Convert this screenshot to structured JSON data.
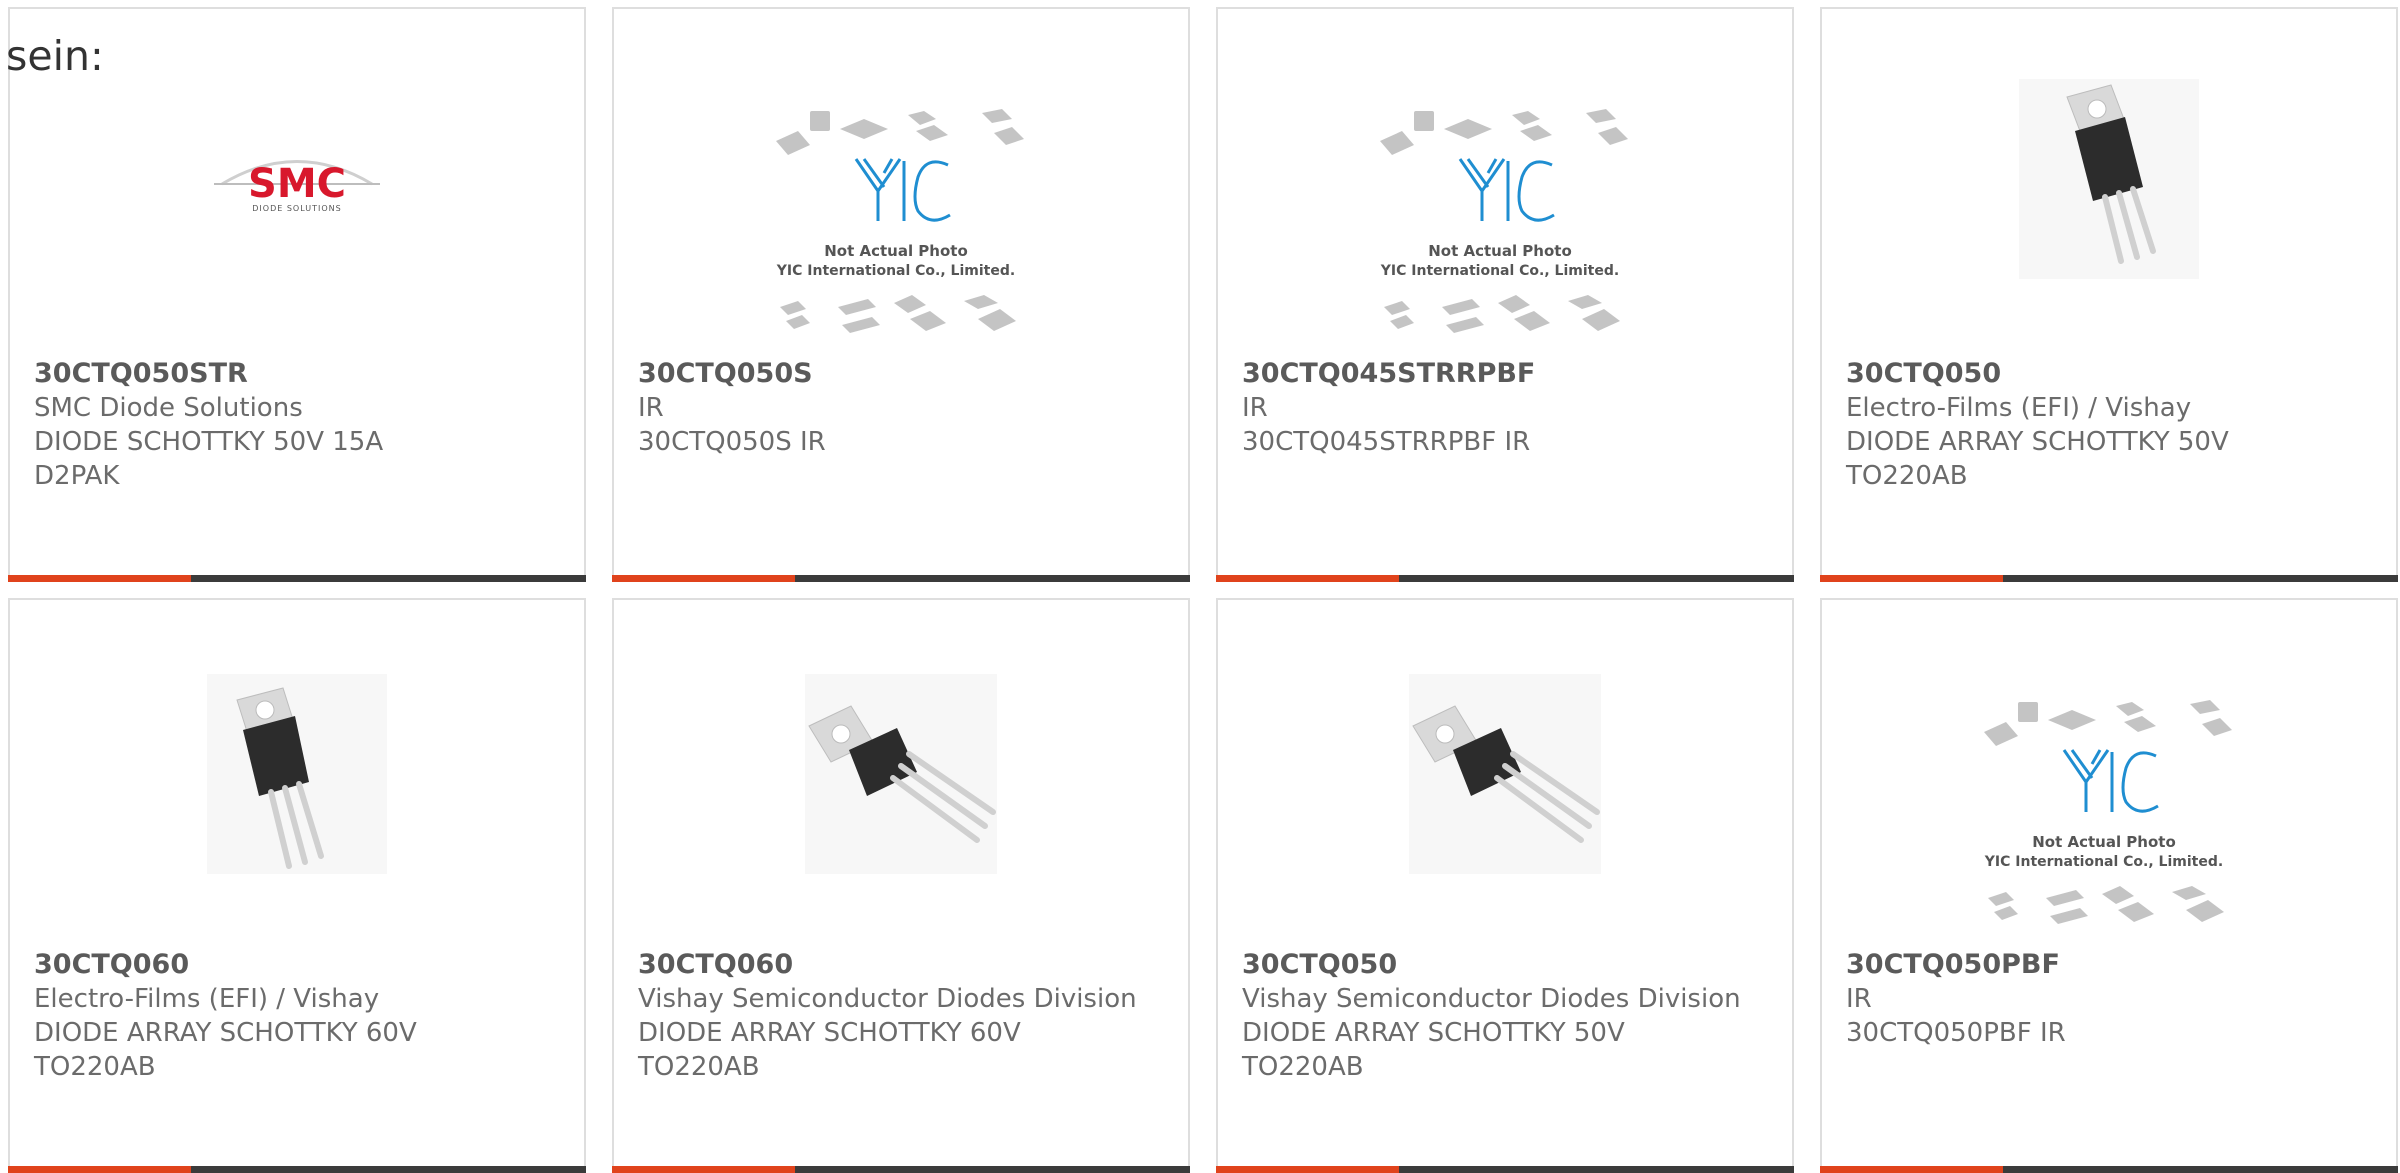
{
  "heading": "sein:",
  "products": [
    {
      "part": "30CTQ050STR",
      "maker": "SMC Diode Solutions",
      "desc": "DIODE SCHOTTKY 50V 15A",
      "pkg": "D2PAK",
      "image": "smc-logo",
      "image_text": "SMC",
      "image_subtext": "DIODE SOLUTIONS"
    },
    {
      "part": "30CTQ050S",
      "maker": "IR",
      "desc": "30CTQ050S IR",
      "pkg": "",
      "image": "yic-placeholder",
      "image_text": "Not Actual Photo",
      "image_subtext": "YIC International Co., Limited."
    },
    {
      "part": "30CTQ045STRRPBF",
      "maker": "IR",
      "desc": "30CTQ045STRRPBF IR",
      "pkg": "",
      "image": "yic-placeholder",
      "image_text": "Not Actual Photo",
      "image_subtext": "YIC International Co., Limited."
    },
    {
      "part": "30CTQ050",
      "maker": "Electro-Films (EFI) / Vishay",
      "desc": "DIODE ARRAY SCHOTTKY 50V",
      "pkg": "TO220AB",
      "image": "to220-front"
    },
    {
      "part": "30CTQ060",
      "maker": "Electro-Films (EFI) / Vishay",
      "desc": "DIODE ARRAY SCHOTTKY 60V",
      "pkg": "TO220AB",
      "image": "to220-front"
    },
    {
      "part": "30CTQ060",
      "maker": "Vishay Semiconductor Diodes Division",
      "desc": "DIODE ARRAY SCHOTTKY 60V",
      "pkg": "TO220AB",
      "image": "to220-angled"
    },
    {
      "part": "30CTQ050",
      "maker": "Vishay Semiconductor Diodes Division",
      "desc": "DIODE ARRAY SCHOTTKY 50V",
      "pkg": "TO220AB",
      "image": "to220-angled"
    },
    {
      "part": "30CTQ050PBF",
      "maker": "IR",
      "desc": "30CTQ050PBF IR",
      "pkg": "",
      "image": "yic-placeholder",
      "image_text": "Not Actual Photo",
      "image_subtext": "YIC International Co., Limited."
    }
  ],
  "colors": {
    "accent": "#e0431c",
    "bar": "#3b3b3b",
    "border": "#dedede",
    "smc_red": "#d8182c",
    "yic_blue": "#1f8ed1"
  }
}
